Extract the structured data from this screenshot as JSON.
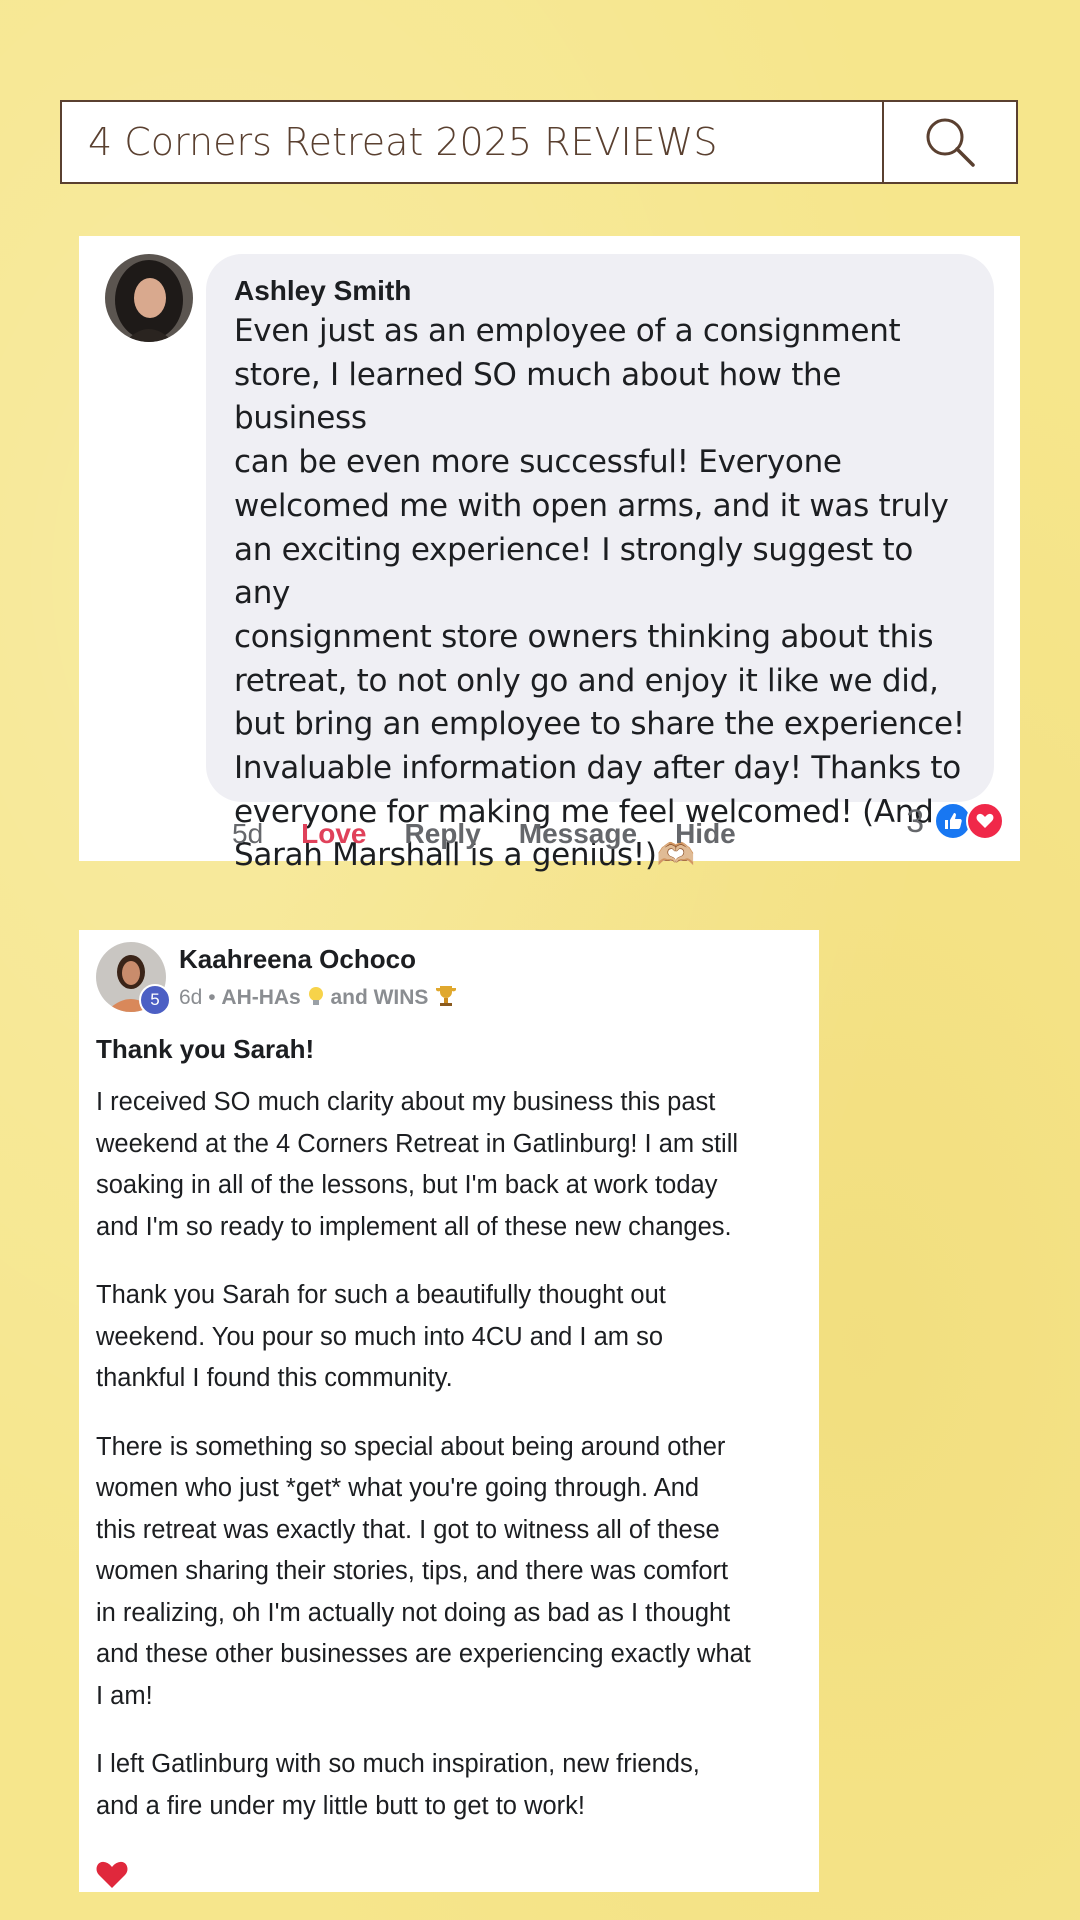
{
  "search": {
    "value": "4 Corners Retreat 2025 REVIEWS"
  },
  "review1": {
    "author": "Ashley Smith",
    "text": "Even just as an employee of a consignment\nstore, I learned SO much about how the business\ncan be even more successful! Everyone\nwelcomed me with open arms, and it was truly\nan exciting experience! I strongly suggest to any\nconsignment store owners thinking about this\nretreat, to not only go and enjoy it like we did,\nbut bring an employee to share the experience!\nInvaluable information day after day! Thanks to\neveryone for making me feel welcomed! (And\nSarah Marshall is a genius!)",
    "emoji": "🫶🏼",
    "actions": {
      "time": "5d",
      "love": "Love",
      "reply": "Reply",
      "message": "Message",
      "hide": "Hide"
    },
    "reaction_count": "3"
  },
  "review2": {
    "author": "Kaahreena Ochoco",
    "badge": "5",
    "meta_time": "6d",
    "meta_sep": "•",
    "group_a": "AH-HAs",
    "group_b": "and WINS",
    "title": "Thank you Sarah!",
    "paragraphs": [
      "I received SO much clarity about my business this past\nweekend at the 4 Corners Retreat in Gatlinburg! I am still\nsoaking in all of the lessons, but I'm back at work today\nand I'm so ready to implement all of these new changes.",
      "Thank you Sarah for such a beautifully thought out\nweekend. You pour so much into 4CU and I am so\nthankful I found this community.",
      "There is something so special about being around other\nwomen who just *get* what you're going through. And\nthis retreat was exactly that. I got to witness all of these\nwomen sharing their stories, tips, and there was comfort\nin realizing, oh I'm actually not doing as bad as I thought\nand these other businesses are experiencing exactly what\nI am!",
      "I left Gatlinburg with so much inspiration, new friends,\nand a fire under my little butt to get to work!"
    ]
  }
}
